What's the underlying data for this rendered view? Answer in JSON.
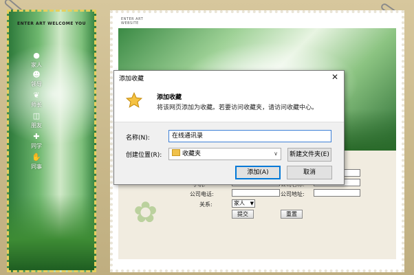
{
  "site": {
    "left_title": "ENTER ART  WELCOME YOU",
    "header_title_line1": "ENTER ART",
    "header_title_line2": "WEBSITE"
  },
  "nav": {
    "items": [
      {
        "label": "家人",
        "icon": "camera-icon"
      },
      {
        "label": "领导",
        "icon": "person-icon"
      },
      {
        "label": "师长",
        "icon": "leaf-icon"
      },
      {
        "label": "朋友",
        "icon": "cart-icon"
      },
      {
        "label": "同学",
        "icon": "plus-icon"
      },
      {
        "label": "同事",
        "icon": "hand-icon"
      }
    ]
  },
  "form": {
    "work_address_label": "公司地址:",
    "company_phone_label": "公司电话:",
    "relation_label": "关系:",
    "relation_value": "家人",
    "submit_label": "提交",
    "reset_label": "重置",
    "partial_label_left": "手机:",
    "partial_label_right": "公司名称:"
  },
  "dialog": {
    "title": "添加收藏",
    "close_glyph": "✕",
    "heading": "添加收藏",
    "description": "将该网页添加为收藏。若要访问收藏夹，请访问收藏中心。",
    "name_label": "名称(N):",
    "name_value": "在线通讯录",
    "location_label": "创建位置(R):",
    "location_value": "收藏夹",
    "new_folder_label": "新建文件夹(E)",
    "add_label": "添加(A)",
    "cancel_label": "取消",
    "accent_color": "#0078d7"
  }
}
